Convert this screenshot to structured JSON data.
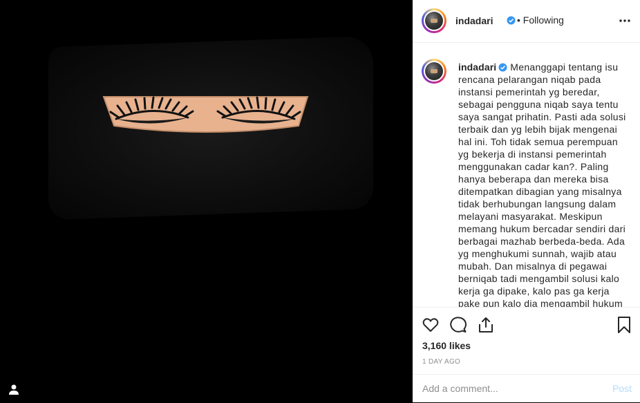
{
  "post": {
    "username": "indadari",
    "verified": true,
    "follow_status": "Following",
    "separator": "•",
    "caption": "Menanggapi tentang isu rencana pelarangan niqab pada instansi pemerintah yg beredar, sebagai pengguna niqab saya tentu saya sangat prihatin. Pasti ada solusi terbaik dan yg lebih bijak mengenai hal ini. Toh tidak semua perempuan yg bekerja di instansi pemerintah menggunakan cadar kan?. Paling hanya beberapa dan mereka bisa ditempatkan dibagian yang misalnya tidak berhubungan langsung dalam melayani masyarakat. Meskipun memang hukum bercadar sendiri dari berbagai mazhab berbeda-beda. Ada yg menghukumi sunnah, wajib atau mubah. Dan misalnya di pegawai berniqab tadi mengambil solusi kalo kerja ga dipake, kalo pas ga kerja pake pun kalo dia mengambil hukum cadar",
    "likes": "3,160 likes",
    "time": "1 DAY AGO"
  },
  "comment_box": {
    "placeholder": "Add a comment...",
    "post_label": "Post"
  },
  "icons": {
    "more": "more-options-icon",
    "like": "heart-icon",
    "comment": "comment-icon",
    "share": "share-icon",
    "save": "bookmark-icon",
    "verified": "verified-badge-icon",
    "user_tag": "user-tag-icon"
  },
  "colors": {
    "verified": "#3897f0",
    "text": "#262626",
    "muted": "#8e8e8e",
    "post_disabled": "#b3dbff",
    "skin": "#e8b28f"
  }
}
